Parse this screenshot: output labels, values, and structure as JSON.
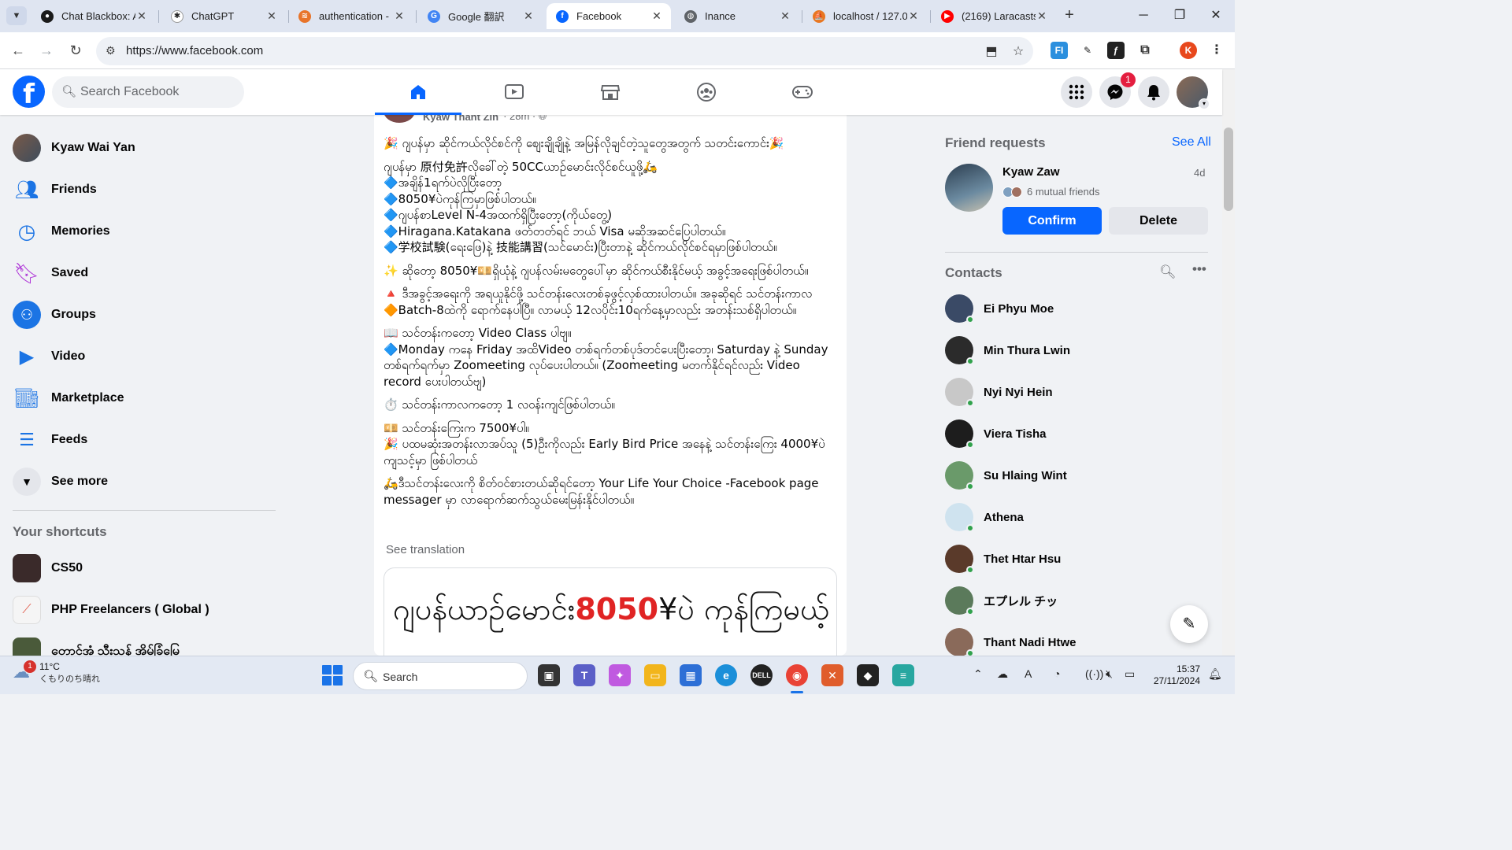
{
  "browser": {
    "tabs": [
      {
        "label": "Chat Blackbox: A",
        "fav_color": "#1a1a1a",
        "fav_glyph": "●",
        "active": false
      },
      {
        "label": "ChatGPT",
        "fav_color": "#ffffff",
        "fav_glyph": "✱",
        "active": false
      },
      {
        "label": "authentication -",
        "fav_color": "#e8742a",
        "fav_glyph": "≋",
        "active": false
      },
      {
        "label": "Google 翻訳",
        "fav_color": "#4285f4",
        "fav_glyph": "G",
        "active": false
      },
      {
        "label": "Facebook",
        "fav_color": "#0866ff",
        "fav_glyph": "f",
        "active": true
      },
      {
        "label": "Inance",
        "fav_color": "#5f6368",
        "fav_glyph": "◍",
        "active": false
      },
      {
        "label": "localhost / 127.0",
        "fav_color": "#e87722",
        "fav_glyph": "⛵",
        "active": false
      },
      {
        "label": "(2169) Laracasts",
        "fav_color": "#ff0000",
        "fav_glyph": "▶",
        "active": false
      }
    ],
    "url": "https://www.facebook.com",
    "profile_initial": "K"
  },
  "fb": {
    "search_placeholder": "Search Facebook",
    "messenger_badge": "1",
    "colors": {
      "brand": "#0866ff",
      "notification": "#e41e3f",
      "online": "#31a24c"
    }
  },
  "sidebar": {
    "items": [
      {
        "label": "Kyaw Wai Yan",
        "icon": "profile-avatar"
      },
      {
        "label": "Friends",
        "icon": "friends-icon"
      },
      {
        "label": "Memories",
        "icon": "memories-icon"
      },
      {
        "label": "Saved",
        "icon": "saved-icon"
      },
      {
        "label": "Groups",
        "icon": "groups-icon"
      },
      {
        "label": "Video",
        "icon": "video-icon"
      },
      {
        "label": "Marketplace",
        "icon": "marketplace-icon"
      },
      {
        "label": "Feeds",
        "icon": "feeds-icon"
      },
      {
        "label": "See more",
        "icon": "chevron-down-icon"
      }
    ],
    "shortcuts_title": "Your shortcuts",
    "shortcuts": [
      {
        "label": "CS50"
      },
      {
        "label": "PHP Freelancers ( Global )"
      },
      {
        "label": "တောင်အုံ့ သီးသန့် အိမ်ခြံမြေ"
      }
    ]
  },
  "post": {
    "author": "Kyaw Thant Zin",
    "time": "28m",
    "paragraphs": [
      [
        "🎉 ဂျပန်မှာ ဆိုင်ကယ်လိုင်စင်ကို စျေးချိုချိုနဲ့ အမြန်လိုချင်တဲ့သူတွေအတွက် သတင်းကောင်း🎉"
      ],
      [
        "ဂျပန်မှာ 原付免許လိုခေါ်တဲ့ 50CCယာဉ်မောင်းလိုင်စင်ယူဖို့🛵",
        "🔷အချိန်1ရက်ပဲလိုပြီးတော့",
        "🔷8050¥ပဲကုန်ကြမှာဖြစ်ပါတယ်။",
        "🔷ဂျပန်စာLevel N-4အထက်ရှိပြီးတော့(ကိုယ်တွေ့)",
        "🔷Hiragana.Katakana ဖတ်တတ်ရင် ဘယ် Visa မဆိုအဆင်ပြေပါတယ်။",
        "🔷学校試験(ရေးဖြေ)နဲ့ 技能講習(သင်မောင်း)ပြီးတာနဲ့ ဆိုင်ကယ်လိုင်စင်ရမှာဖြစ်ပါတယ်။"
      ],
      [
        "✨ ဆိုတော့ 8050¥💴ရှိယုံနဲ့ ဂျပန်လမ်းမတွေပေါ်မှာ ဆိုင်ကယ်စီးနိုင်မယ့် အခွင့်အရေးဖြစ်ပါတယ်။"
      ],
      [
        "🔺 ဒီအခွင့်အရေးကို အရယူနိုင်ဖို့ သင်တန်းလေးတစ်ခုဖွင့်လှစ်ထားပါတယ်။ အခုဆိုရင် သင်တန်းကာလ 🔶Batch-8ထဲကို ရောက်နေပါပြီ။ လာမယ့် 12လပိုင်း10ရက်နေ့မှာလည်း အတန်းသစ်ရှိပါတယ်။"
      ],
      [
        "📖 သင်တန်းကတော့ Video Class ပါဗျ။",
        "🔷Monday ကနေ Friday အထိVideo တစ်ရက်တစ်ပုဒ်တင်ပေးပြီးတော့၊ Saturday နဲ့ Sunday တစ်ရက်ရက်မှာ Zoomeeting လုပ်ပေးပါတယ်။ (Zoomeeting မတက်နိုင်ရင်လည်း Video record ပေးပါတယ်ဗျ)"
      ],
      [
        "⏱️ သင်တန်းကာလကတော့ 1 လဝန်းကျင်ဖြစ်ပါတယ်။"
      ],
      [
        "💴 သင်တန်းကြေးက 7500¥ပါ။",
        "🎉 ပထမဆုံးအတန်းလာအပ်သူ (5)ဦးကိုလည်း Early Bird Price အနေနဲ့ သင်တန်းကြေး 4000¥ပဲ ကျသင့်မှာ ဖြစ်ပါတယ်"
      ],
      [
        "🛵ဒီသင်တန်းလေးကို စိတ်ဝင်စားတယ်ဆိုရင်တော့ Your Life Your Choice -Facebook page messager မှာ လာရောက်ဆက်သွယ်မေးမြန်းနိုင်ပါတယ်။"
      ]
    ],
    "see_translation": "See translation",
    "image_text_before": "ဂျပန်ယာဉ်မောင်း",
    "image_text_price": "8050",
    "image_text_after": "¥ပဲ ကုန်ကြမယ့်"
  },
  "right": {
    "friend_requests_title": "Friend requests",
    "see_all": "See All",
    "request": {
      "name": "Kyaw Zaw",
      "time": "4d",
      "mutual": "6 mutual friends",
      "confirm": "Confirm",
      "delete": "Delete"
    },
    "contacts_title": "Contacts",
    "contacts": [
      {
        "name": "Ei Phyu Moe",
        "color": "#3a4a66"
      },
      {
        "name": "Min Thura Lwin",
        "color": "#2b2b2b"
      },
      {
        "name": "Nyi Nyi Hein",
        "color": "#c8c8c8"
      },
      {
        "name": "Viera Tisha",
        "color": "#1d1d1d"
      },
      {
        "name": "Su Hlaing Wint",
        "color": "#6a9a6a"
      },
      {
        "name": "Athena",
        "color": "#cfe3ef"
      },
      {
        "name": "Thet Htar Hsu",
        "color": "#5a3a2a"
      },
      {
        "name": "エプレル チッ",
        "color": "#5b7a5b"
      },
      {
        "name": "Thant Nadi Htwe",
        "color": "#8a6a5a"
      }
    ]
  },
  "taskbar": {
    "weather_temp": "11°C",
    "weather_desc": "くもりのち晴れ",
    "weather_badge": "1",
    "search_label": "Search",
    "time": "15:37",
    "date": "27/11/2024"
  }
}
